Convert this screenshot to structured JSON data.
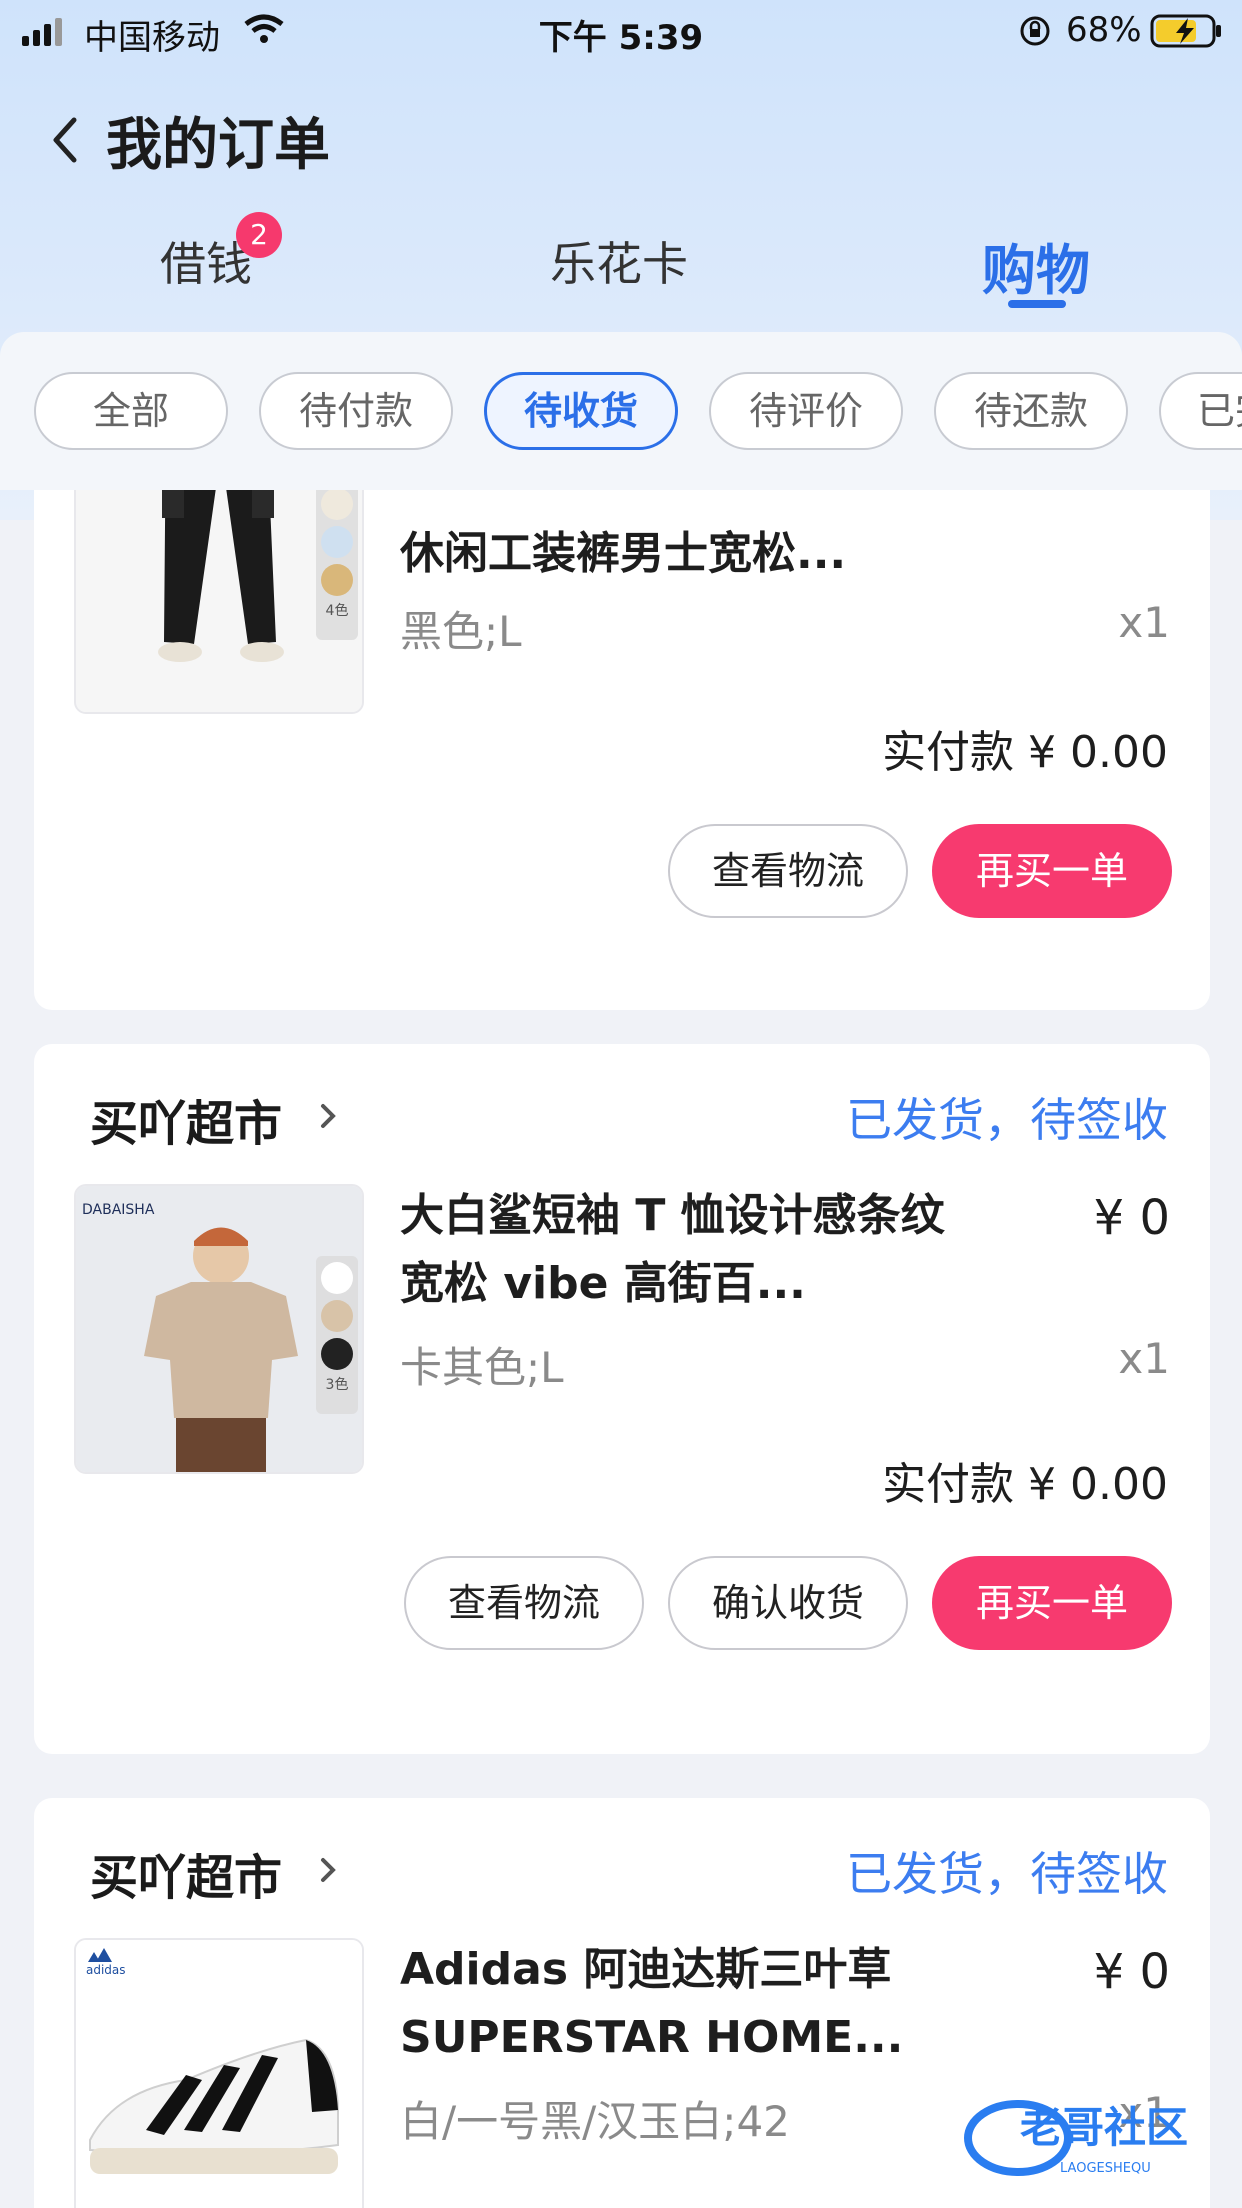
{
  "status_bar": {
    "carrier": "中国移动",
    "time": "下午 5:39",
    "battery": "68%"
  },
  "nav": {
    "title": "我的订单",
    "tabs": [
      {
        "label": "借钱",
        "badge": "2"
      },
      {
        "label": "乐花卡"
      },
      {
        "label": "购物",
        "active": true
      }
    ]
  },
  "filters": [
    {
      "label": "全部"
    },
    {
      "label": "待付款"
    },
    {
      "label": "待收货",
      "active": true
    },
    {
      "label": "待评价"
    },
    {
      "label": "待还款"
    },
    {
      "label": "已完成"
    }
  ],
  "orders": [
    {
      "product_title": "休闲工装裤男士宽松...",
      "spec": "黑色;L",
      "qty": "x1",
      "paid": "实付款 ¥ 0.00",
      "variant_count": "4色",
      "buttons": [
        "查看物流",
        "再买一单"
      ]
    },
    {
      "shop": "买吖超市",
      "status": "已发货，待签收",
      "product_title": "大白鲨短袖 T 恤设计感条纹宽松 vibe 高街百...",
      "price": "¥ 0",
      "spec": "卡其色;L",
      "qty": "x1",
      "paid": "实付款 ¥ 0.00",
      "brand_logo": "DABAISHA",
      "variant_count": "3色",
      "buttons": [
        "查看物流",
        "确认收货",
        "再买一单"
      ]
    },
    {
      "shop": "买吖超市",
      "status": "已发货，待签收",
      "product_title": "Adidas 阿迪达斯三叶草 SUPERSTAR HOME...",
      "price": "¥ 0",
      "spec": "白/一号黑/汉玉白;42",
      "qty": "x1",
      "brand_logo": "adidas"
    }
  ],
  "watermark": {
    "text": "老哥社区",
    "subtext": "LAOGESHEQU"
  },
  "colors": {
    "accent": "#2b6fe8",
    "primary_button": "#f73a6f",
    "status_text": "#3c7df0",
    "badge": "#f6396d"
  }
}
